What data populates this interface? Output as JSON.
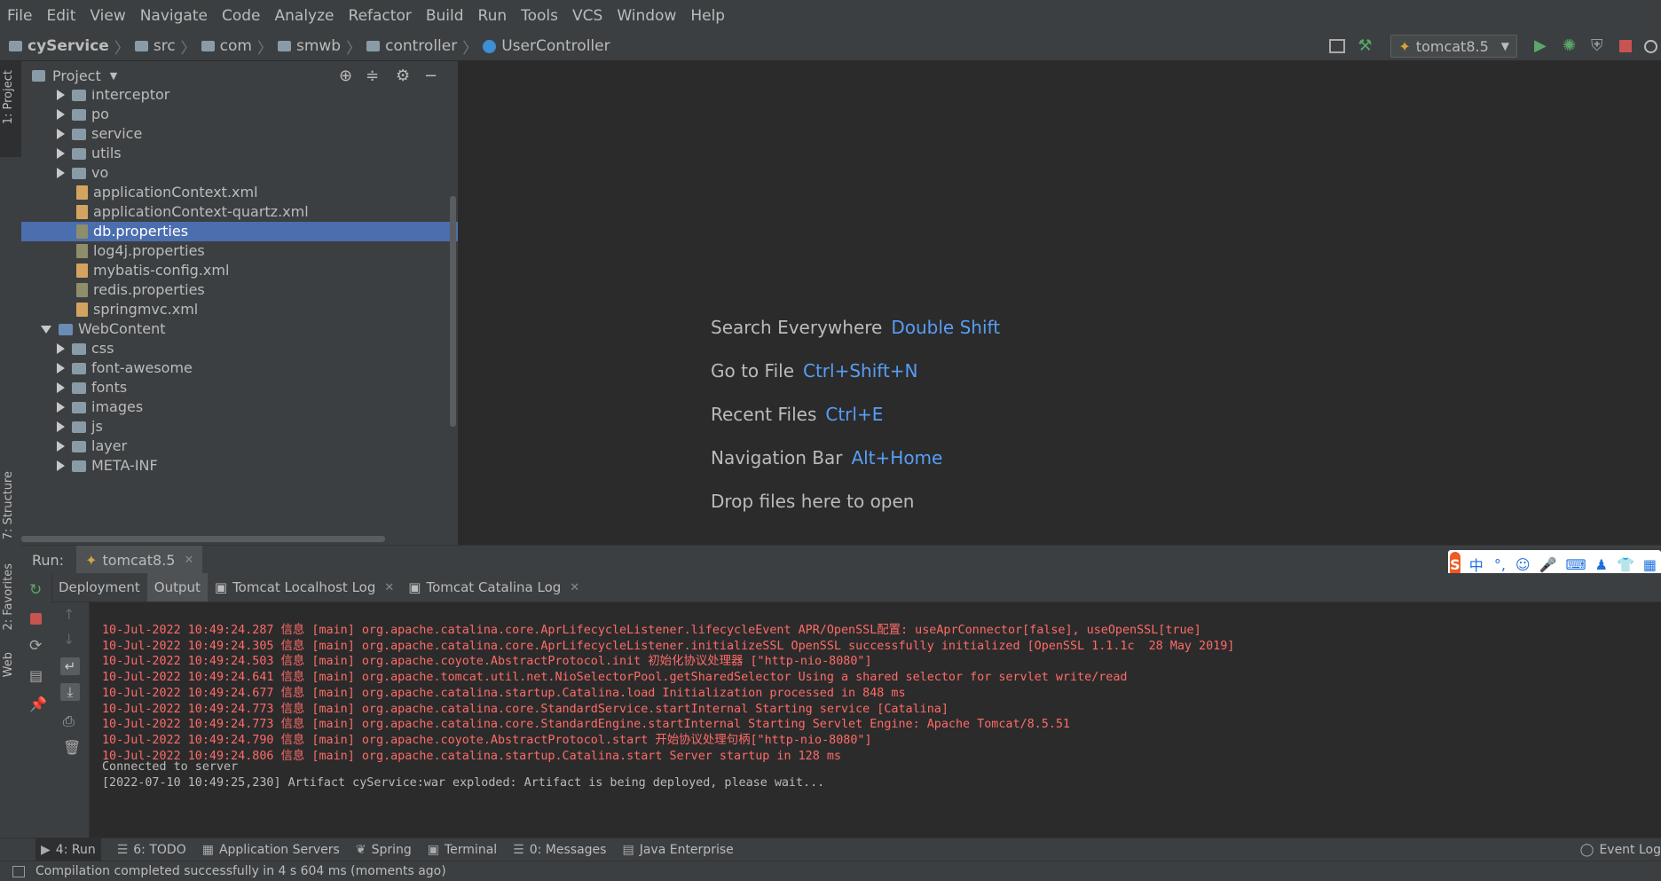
{
  "menu": [
    "File",
    "Edit",
    "View",
    "Navigate",
    "Code",
    "Analyze",
    "Refactor",
    "Build",
    "Run",
    "Tools",
    "VCS",
    "Window",
    "Help"
  ],
  "breadcrumb": [
    "cyService",
    "src",
    "com",
    "smwb",
    "controller",
    "UserController"
  ],
  "run_config": "tomcat8.5",
  "project_panel": {
    "title": "Project"
  },
  "tree": [
    {
      "label": "interceptor",
      "type": "package",
      "depth": 1,
      "expanded": false
    },
    {
      "label": "po",
      "type": "package",
      "depth": 1,
      "expanded": false
    },
    {
      "label": "service",
      "type": "package",
      "depth": 1,
      "expanded": false
    },
    {
      "label": "utils",
      "type": "package",
      "depth": 1,
      "expanded": false
    },
    {
      "label": "vo",
      "type": "package",
      "depth": 1,
      "expanded": false
    },
    {
      "label": "applicationContext.xml",
      "type": "xml",
      "depth": 1
    },
    {
      "label": "applicationContext-quartz.xml",
      "type": "xml",
      "depth": 1
    },
    {
      "label": "db.properties",
      "type": "properties",
      "depth": 1,
      "selected": true
    },
    {
      "label": "log4j.properties",
      "type": "properties",
      "depth": 1
    },
    {
      "label": "mybatis-config.xml",
      "type": "xml",
      "depth": 1
    },
    {
      "label": "redis.properties",
      "type": "properties",
      "depth": 1
    },
    {
      "label": "springmvc.xml",
      "type": "xml",
      "depth": 1
    },
    {
      "label": "WebContent",
      "type": "web",
      "depth": 0,
      "expanded": true
    },
    {
      "label": "css",
      "type": "folder",
      "depth": 1,
      "expanded": false
    },
    {
      "label": "font-awesome",
      "type": "folder",
      "depth": 1,
      "expanded": false
    },
    {
      "label": "fonts",
      "type": "folder",
      "depth": 1,
      "expanded": false
    },
    {
      "label": "images",
      "type": "folder",
      "depth": 1,
      "expanded": false
    },
    {
      "label": "js",
      "type": "folder",
      "depth": 1,
      "expanded": false
    },
    {
      "label": "layer",
      "type": "folder",
      "depth": 1,
      "expanded": false
    },
    {
      "label": "META-INF",
      "type": "folder",
      "depth": 1,
      "expanded": false
    }
  ],
  "editor_hints": [
    {
      "label": "Search Everywhere",
      "key": "Double Shift"
    },
    {
      "label": "Go to File",
      "key": "Ctrl+Shift+N"
    },
    {
      "label": "Recent Files",
      "key": "Ctrl+E"
    },
    {
      "label": "Navigation Bar",
      "key": "Alt+Home"
    },
    {
      "label": "Drop files here to open",
      "key": ""
    }
  ],
  "run_panel": {
    "label": "Run:",
    "tab": "tomcat8.5",
    "subtabs": [
      "Deployment",
      "Output",
      "Tomcat Localhost Log",
      "Tomcat Catalina Log"
    ],
    "active_subtab": "Output"
  },
  "console": [
    {
      "text": "10-Jul-2022 10:49:24.287 信息 [main] org.apache.catalina.core.AprLifecycleListener.lifecycleEvent APR/OpenSSL配置: useAprConnector[false], useOpenSSL[true]",
      "color": "red"
    },
    {
      "text": "10-Jul-2022 10:49:24.305 信息 [main] org.apache.catalina.core.AprLifecycleListener.initializeSSL OpenSSL successfully initialized [OpenSSL 1.1.1c  28 May 2019]",
      "color": "red"
    },
    {
      "text": "10-Jul-2022 10:49:24.503 信息 [main] org.apache.coyote.AbstractProtocol.init 初始化协议处理器 [\"http-nio-8080\"]",
      "color": "red"
    },
    {
      "text": "10-Jul-2022 10:49:24.641 信息 [main] org.apache.tomcat.util.net.NioSelectorPool.getSharedSelector Using a shared selector for servlet write/read",
      "color": "red"
    },
    {
      "text": "10-Jul-2022 10:49:24.677 信息 [main] org.apache.catalina.startup.Catalina.load Initialization processed in 848 ms",
      "color": "red"
    },
    {
      "text": "10-Jul-2022 10:49:24.773 信息 [main] org.apache.catalina.core.StandardService.startInternal Starting service [Catalina]",
      "color": "red"
    },
    {
      "text": "10-Jul-2022 10:49:24.773 信息 [main] org.apache.catalina.core.StandardEngine.startInternal Starting Servlet Engine: Apache Tomcat/8.5.51",
      "color": "red"
    },
    {
      "text": "10-Jul-2022 10:49:24.790 信息 [main] org.apache.coyote.AbstractProtocol.start 开始协议处理句柄[\"http-nio-8080\"]",
      "color": "red"
    },
    {
      "text": "10-Jul-2022 10:49:24.806 信息 [main] org.apache.catalina.startup.Catalina.start Server startup in 128 ms",
      "color": "red"
    },
    {
      "text": "Connected to server",
      "color": "gray"
    },
    {
      "text": "[2022-07-10 10:49:25,230] Artifact cyService:war exploded: Artifact is being deployed, please wait...",
      "color": "gray"
    }
  ],
  "left_stripe": [
    "1: Project",
    "7: Structure",
    "2: Favorites",
    "Web"
  ],
  "tool_windows": [
    {
      "label": "4: Run",
      "icon": "run-icon"
    },
    {
      "label": "6: TODO",
      "icon": "todo-icon"
    },
    {
      "label": "Application Servers",
      "icon": "server-icon"
    },
    {
      "label": "Spring",
      "icon": "spring-icon"
    },
    {
      "label": "Terminal",
      "icon": "terminal-icon"
    },
    {
      "label": "0: Messages",
      "icon": "messages-icon"
    },
    {
      "label": "Java Enterprise",
      "icon": "java-enterprise-icon"
    }
  ],
  "event_log": "Event Log",
  "status": "Compilation completed successfully in 4 s 604 ms (moments ago)",
  "ime": {
    "label": "中",
    "punct": "°,"
  },
  "colors": {
    "selection": "#4b6eaf",
    "link": "#589df6",
    "error": "#ff6b68",
    "background": "#2b2b2b",
    "panel": "#3c3f41"
  }
}
